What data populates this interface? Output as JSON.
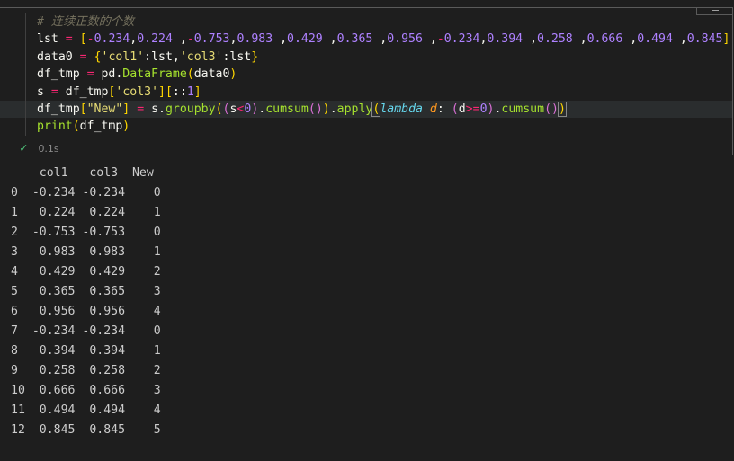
{
  "code_lines": [
    [
      {
        "c": "kw-comment",
        "t": "# 连续正数的个数"
      }
    ],
    [
      {
        "c": "t-var",
        "t": "lst "
      },
      {
        "c": "t-op",
        "t": "="
      },
      {
        "c": "t-var",
        "t": " "
      },
      {
        "c": "t-b1",
        "t": "["
      },
      {
        "c": "t-op",
        "t": "-"
      },
      {
        "c": "t-num",
        "t": "0.234"
      },
      {
        "c": "t-var",
        "t": ","
      },
      {
        "c": "t-num",
        "t": "0.224"
      },
      {
        "c": "t-var",
        "t": " ,"
      },
      {
        "c": "t-op",
        "t": "-"
      },
      {
        "c": "t-num",
        "t": "0.753"
      },
      {
        "c": "t-var",
        "t": ","
      },
      {
        "c": "t-num",
        "t": "0.983"
      },
      {
        "c": "t-var",
        "t": " ,"
      },
      {
        "c": "t-num",
        "t": "0.429"
      },
      {
        "c": "t-var",
        "t": " ,"
      },
      {
        "c": "t-num",
        "t": "0.365"
      },
      {
        "c": "t-var",
        "t": " ,"
      },
      {
        "c": "t-num",
        "t": "0.956"
      },
      {
        "c": "t-var",
        "t": " ,"
      },
      {
        "c": "t-op",
        "t": "-"
      },
      {
        "c": "t-num",
        "t": "0.234"
      },
      {
        "c": "t-var",
        "t": ","
      },
      {
        "c": "t-num",
        "t": "0.394"
      },
      {
        "c": "t-var",
        "t": " ,"
      },
      {
        "c": "t-num",
        "t": "0.258"
      },
      {
        "c": "t-var",
        "t": " ,"
      },
      {
        "c": "t-num",
        "t": "0.666"
      },
      {
        "c": "t-var",
        "t": " ,"
      },
      {
        "c": "t-num",
        "t": "0.494"
      },
      {
        "c": "t-var",
        "t": " ,"
      },
      {
        "c": "t-num",
        "t": "0.845"
      },
      {
        "c": "t-b1",
        "t": "]"
      }
    ],
    [
      {
        "c": "t-var",
        "t": "data0 "
      },
      {
        "c": "t-op",
        "t": "="
      },
      {
        "c": "t-var",
        "t": " "
      },
      {
        "c": "t-b1",
        "t": "{"
      },
      {
        "c": "t-str",
        "t": "'col1'"
      },
      {
        "c": "t-var",
        "t": ":lst,"
      },
      {
        "c": "t-str",
        "t": "'col3'"
      },
      {
        "c": "t-var",
        "t": ":lst"
      },
      {
        "c": "t-b1",
        "t": "}"
      }
    ],
    [
      {
        "c": "t-var",
        "t": "df_tmp "
      },
      {
        "c": "t-op",
        "t": "="
      },
      {
        "c": "t-var",
        "t": " pd."
      },
      {
        "c": "t-fn",
        "t": "DataFrame"
      },
      {
        "c": "t-b1",
        "t": "("
      },
      {
        "c": "t-var",
        "t": "data0"
      },
      {
        "c": "t-b1",
        "t": ")"
      }
    ],
    [
      {
        "c": "t-var",
        "t": "s "
      },
      {
        "c": "t-op",
        "t": "="
      },
      {
        "c": "t-var",
        "t": " df_tmp"
      },
      {
        "c": "t-b1",
        "t": "["
      },
      {
        "c": "t-str",
        "t": "'col3'"
      },
      {
        "c": "t-b1",
        "t": "]"
      },
      {
        "c": "t-b1",
        "t": "["
      },
      {
        "c": "t-var",
        "t": "::"
      },
      {
        "c": "t-num",
        "t": "1"
      },
      {
        "c": "t-b1",
        "t": "]"
      }
    ],
    [
      {
        "c": "t-var",
        "t": "df_tmp"
      },
      {
        "c": "t-b1",
        "t": "["
      },
      {
        "c": "t-str",
        "t": "\"New\""
      },
      {
        "c": "t-b1",
        "t": "]"
      },
      {
        "c": "t-var",
        "t": " "
      },
      {
        "c": "t-op",
        "t": "="
      },
      {
        "c": "t-var",
        "t": " s."
      },
      {
        "c": "t-fn",
        "t": "groupby"
      },
      {
        "c": "t-b1",
        "t": "("
      },
      {
        "c": "t-b2",
        "t": "("
      },
      {
        "c": "t-var",
        "t": "s"
      },
      {
        "c": "t-op",
        "t": "<"
      },
      {
        "c": "t-num",
        "t": "0"
      },
      {
        "c": "t-b2",
        "t": ")"
      },
      {
        "c": "t-var",
        "t": "."
      },
      {
        "c": "t-fn",
        "t": "cumsum"
      },
      {
        "c": "t-b2",
        "t": "()"
      },
      {
        "c": "t-b1",
        "t": ")"
      },
      {
        "c": "t-var",
        "t": "."
      },
      {
        "c": "t-fn",
        "t": "apply"
      },
      {
        "c": "t-b1 bm",
        "t": "("
      },
      {
        "c": "t-lambda",
        "t": "lambda"
      },
      {
        "c": "t-var",
        "t": " "
      },
      {
        "c": "t-param",
        "t": "d"
      },
      {
        "c": "t-var",
        "t": ": "
      },
      {
        "c": "t-b2",
        "t": "("
      },
      {
        "c": "t-var",
        "t": "d"
      },
      {
        "c": "t-op",
        "t": ">="
      },
      {
        "c": "t-num",
        "t": "0"
      },
      {
        "c": "t-b2",
        "t": ")"
      },
      {
        "c": "t-var",
        "t": "."
      },
      {
        "c": "t-fn",
        "t": "cumsum"
      },
      {
        "c": "t-b2",
        "t": "()"
      },
      {
        "c": "t-b1 bm",
        "t": ")"
      }
    ],
    [
      {
        "c": "t-fn",
        "t": "print"
      },
      {
        "c": "t-b1",
        "t": "("
      },
      {
        "c": "t-var",
        "t": "df_tmp"
      },
      {
        "c": "t-b1",
        "t": ")"
      }
    ]
  ],
  "active_line": 5,
  "status": {
    "icon": "check-icon",
    "glyph": "✓",
    "time": "0.1s"
  },
  "output_lines": [
    "    col1   col3  New",
    "0  -0.234 -0.234    0",
    "1   0.224  0.224    1",
    "2  -0.753 -0.753    0",
    "3   0.983  0.983    1",
    "4   0.429  0.429    2",
    "5   0.365  0.365    3",
    "6   0.956  0.956    4",
    "7  -0.234 -0.234    0",
    "8   0.394  0.394    1",
    "9   0.258  0.258    2",
    "10  0.666  0.666    3",
    "11  0.494  0.494    4",
    "12  0.845  0.845    5"
  ]
}
